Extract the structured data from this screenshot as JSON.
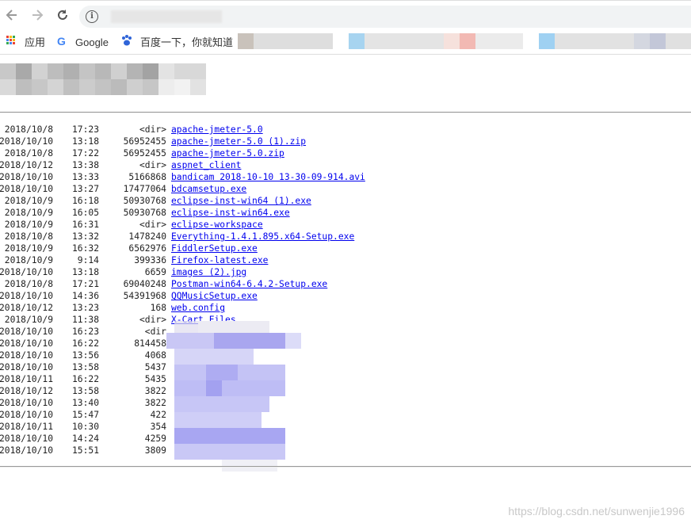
{
  "browser": {
    "back_icon": "arrow-left",
    "forward_icon": "arrow-right",
    "reload_icon": "reload",
    "info_icon": "info"
  },
  "bookmarks": {
    "apps_label": "应用",
    "google_label": "Google",
    "baidu_label": "百度一下，你就知道"
  },
  "listing": {
    "rows": [
      {
        "date": "2018/10/8",
        "time": "17:23",
        "size": "<dir>",
        "name": "apache-jmeter-5.0"
      },
      {
        "date": "2018/10/10",
        "time": "13:18",
        "size": "56952455",
        "name": "apache-jmeter-5.0 (1).zip"
      },
      {
        "date": "2018/10/8",
        "time": "17:22",
        "size": "56952455",
        "name": "apache-jmeter-5.0.zip"
      },
      {
        "date": "2018/10/12",
        "time": "13:38",
        "size": "<dir>",
        "name": "aspnet_client"
      },
      {
        "date": "2018/10/10",
        "time": "13:33",
        "size": "5166868",
        "name": "bandicam 2018-10-10 13-30-09-914.avi"
      },
      {
        "date": "2018/10/10",
        "time": "13:27",
        "size": "17477064",
        "name": "bdcamsetup.exe"
      },
      {
        "date": "2018/10/9",
        "time": "16:18",
        "size": "50930768",
        "name": "eclipse-inst-win64 (1).exe"
      },
      {
        "date": "2018/10/9",
        "time": "16:05",
        "size": "50930768",
        "name": "eclipse-inst-win64.exe"
      },
      {
        "date": "2018/10/9",
        "time": "16:31",
        "size": "<dir>",
        "name": "eclipse-workspace"
      },
      {
        "date": "2018/10/8",
        "time": "13:32",
        "size": "1478240",
        "name": "Everything-1.4.1.895.x64-Setup.exe"
      },
      {
        "date": "2018/10/9",
        "time": "16:32",
        "size": "6562976",
        "name": "FiddlerSetup.exe"
      },
      {
        "date": "2018/10/9",
        "time": "9:14",
        "size": "399336",
        "name": "Firefox-latest.exe"
      },
      {
        "date": "2018/10/10",
        "time": "13:18",
        "size": "6659",
        "name": "images (2).jpg"
      },
      {
        "date": "2018/10/8",
        "time": "17:21",
        "size": "69040248",
        "name": "Postman-win64-6.4.2-Setup.exe"
      },
      {
        "date": "2018/10/10",
        "time": "14:36",
        "size": "54391968",
        "name": "QQMusicSetup.exe"
      },
      {
        "date": "2018/10/12",
        "time": "13:23",
        "size": "168",
        "name": "web.config"
      },
      {
        "date": "2018/10/9",
        "time": "11:38",
        "size": "<dir>",
        "name": "X-Cart Files"
      },
      {
        "date": "2018/10/10",
        "time": "16:23",
        "size": "<dir",
        "name": ""
      },
      {
        "date": "2018/10/10",
        "time": "16:22",
        "size": "814458",
        "name": ""
      },
      {
        "date": "2018/10/10",
        "time": "13:56",
        "size": "4068",
        "name": ""
      },
      {
        "date": "2018/10/10",
        "time": "13:58",
        "size": "5437",
        "name": ""
      },
      {
        "date": "2018/10/11",
        "time": "16:22",
        "size": "5435",
        "name": ""
      },
      {
        "date": "2018/10/12",
        "time": "13:58",
        "size": "3822",
        "name": ""
      },
      {
        "date": "2018/10/10",
        "time": "13:40",
        "size": "3822",
        "name": ""
      },
      {
        "date": "2018/10/10",
        "time": "15:47",
        "size": "422",
        "name": ""
      },
      {
        "date": "2018/10/11",
        "time": "10:30",
        "size": "354",
        "name": ""
      },
      {
        "date": "2018/10/10",
        "time": "14:24",
        "size": "4259",
        "name": ""
      },
      {
        "date": "2018/10/10",
        "time": "15:51",
        "size": "3809",
        "name": ""
      }
    ]
  },
  "watermark": "https://blog.csdn.net/sunwenjie1996",
  "colors": {
    "link": "#0000ee",
    "blur_purple": "#b3b3f5"
  }
}
